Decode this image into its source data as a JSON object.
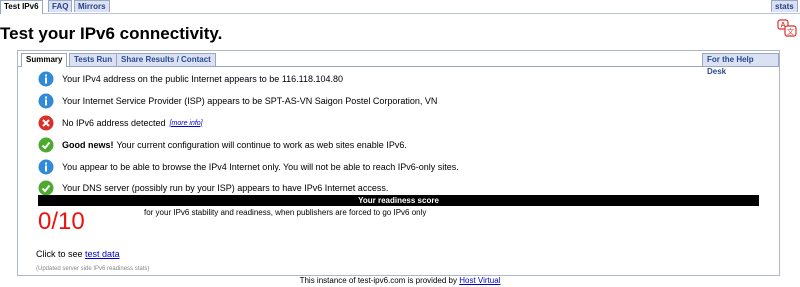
{
  "top_tabs": [
    "Test IPv6",
    "FAQ",
    "Mirrors"
  ],
  "stats_label": "stats",
  "page_title": "Test your IPv6 connectivity.",
  "sub_tabs": [
    "Summary",
    "Tests Run",
    "Share Results / Contact"
  ],
  "help_desk_label": "For the Help Desk",
  "results": [
    {
      "icon": "info-icon",
      "text": "Your IPv4 address on the public Internet appears to be 116.118.104.80"
    },
    {
      "icon": "info-icon",
      "text": "Your Internet Service Provider (ISP) appears to be SPT-AS-VN Saigon Postel Corporation, VN"
    },
    {
      "icon": "error-icon",
      "text": "No IPv6 address detected",
      "more": "[more info]"
    },
    {
      "icon": "check-icon",
      "bold": "Good news!",
      "text": "Your current configuration will continue to work as web sites enable IPv6."
    },
    {
      "icon": "info-icon",
      "text": "You appear to be able to browse the IPv4 Internet only. You will not be able to reach IPv6-only sites."
    },
    {
      "icon": "check-icon",
      "text": "Your DNS server (possibly run by your ISP) appears to have IPv6 Internet access."
    }
  ],
  "readiness": {
    "header": "Your readiness score",
    "score": "0/10",
    "description": "for your IPv6 stability and readiness, when publishers are forced to go IPv6 only"
  },
  "test_data": {
    "prefix": "Click to see",
    "link": "test data"
  },
  "updated_note": "(Updated server side IPv6 readiness stats)",
  "footer": {
    "text": "This instance of test-ipv6.com is provided by",
    "link": "Host Virtual"
  },
  "colors": {
    "info": "#2f8bd8",
    "error": "#d9302a",
    "check": "#4caa2e",
    "score": "#e11111",
    "tab_bg": "#d9e1f2"
  }
}
